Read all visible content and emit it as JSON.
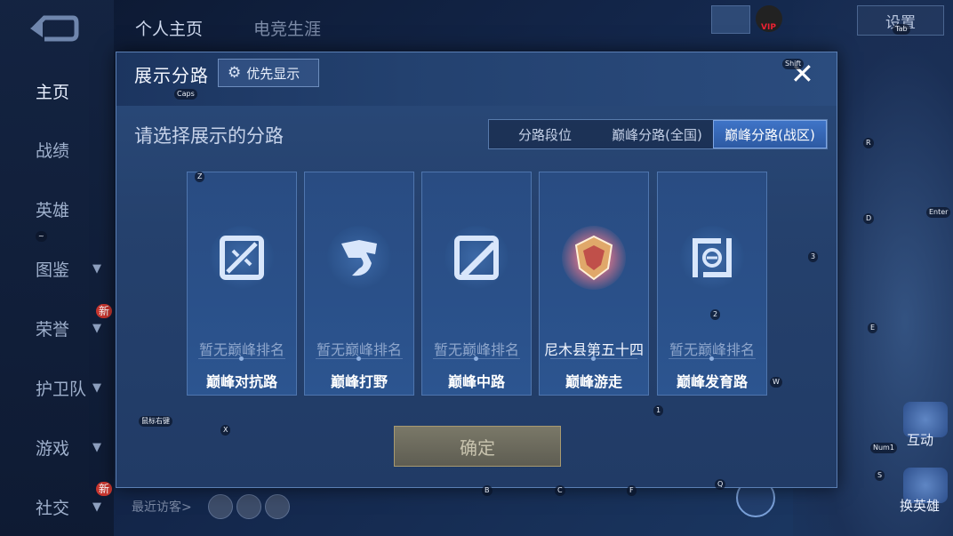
{
  "sidebar": {
    "items": [
      {
        "label": "主页",
        "chevron": false
      },
      {
        "label": "战绩",
        "chevron": false
      },
      {
        "label": "英雄",
        "chevron": false
      },
      {
        "label": "图鉴",
        "chevron": true
      },
      {
        "label": "荣誉",
        "chevron": true,
        "badge": "新"
      },
      {
        "label": "护卫队",
        "chevron": true
      },
      {
        "label": "游戏",
        "chevron": true
      },
      {
        "label": "社交",
        "chevron": true,
        "badge": "新"
      }
    ]
  },
  "top": {
    "tab1": "个人主页",
    "tab2": "电竞生涯",
    "settings": "设置",
    "vip": "VIP"
  },
  "recent_visitors": "最近访客>",
  "side_buttons": {
    "b1": "互动",
    "b2": "换英雄"
  },
  "modal": {
    "title": "展示分路",
    "priority_button": "优先显示",
    "prompt": "请选择展示的分路",
    "segments": [
      {
        "label": "分路段位",
        "selected": false
      },
      {
        "label": "巅峰分路(全国)",
        "selected": false
      },
      {
        "label": "巅峰分路(战区)",
        "selected": true
      }
    ],
    "cards": [
      {
        "rank": "暂无巅峰排名",
        "name": "巅峰对抗路",
        "icon": "sword-icon",
        "has_rank": false
      },
      {
        "rank": "暂无巅峰排名",
        "name": "巅峰打野",
        "icon": "dragon-icon",
        "has_rank": false
      },
      {
        "rank": "暂无巅峰排名",
        "name": "巅峰中路",
        "icon": "slash-icon",
        "has_rank": false
      },
      {
        "rank": "尼木县第五十四",
        "name": "巅峰游走",
        "icon": "gold-shield-icon",
        "has_rank": true
      },
      {
        "rank": "暂无巅峰排名",
        "name": "巅峰发育路",
        "icon": "bow-icon",
        "has_rank": false
      }
    ],
    "confirm": "确定"
  },
  "key_hints": {
    "caps": "Caps",
    "shift": "Shift",
    "z": "Z",
    "x": "X",
    "r": "R",
    "d": "D",
    "enter": "Enter",
    "n3": "3",
    "e": "E",
    "n2": "2",
    "w": "W",
    "n1": "1",
    "b": "B",
    "c": "C",
    "f": "F",
    "q": "Q",
    "s": "S",
    "num1": "Num1",
    "mouse": "鼠标右键",
    "tilde": "~",
    "tab": "Tab"
  }
}
